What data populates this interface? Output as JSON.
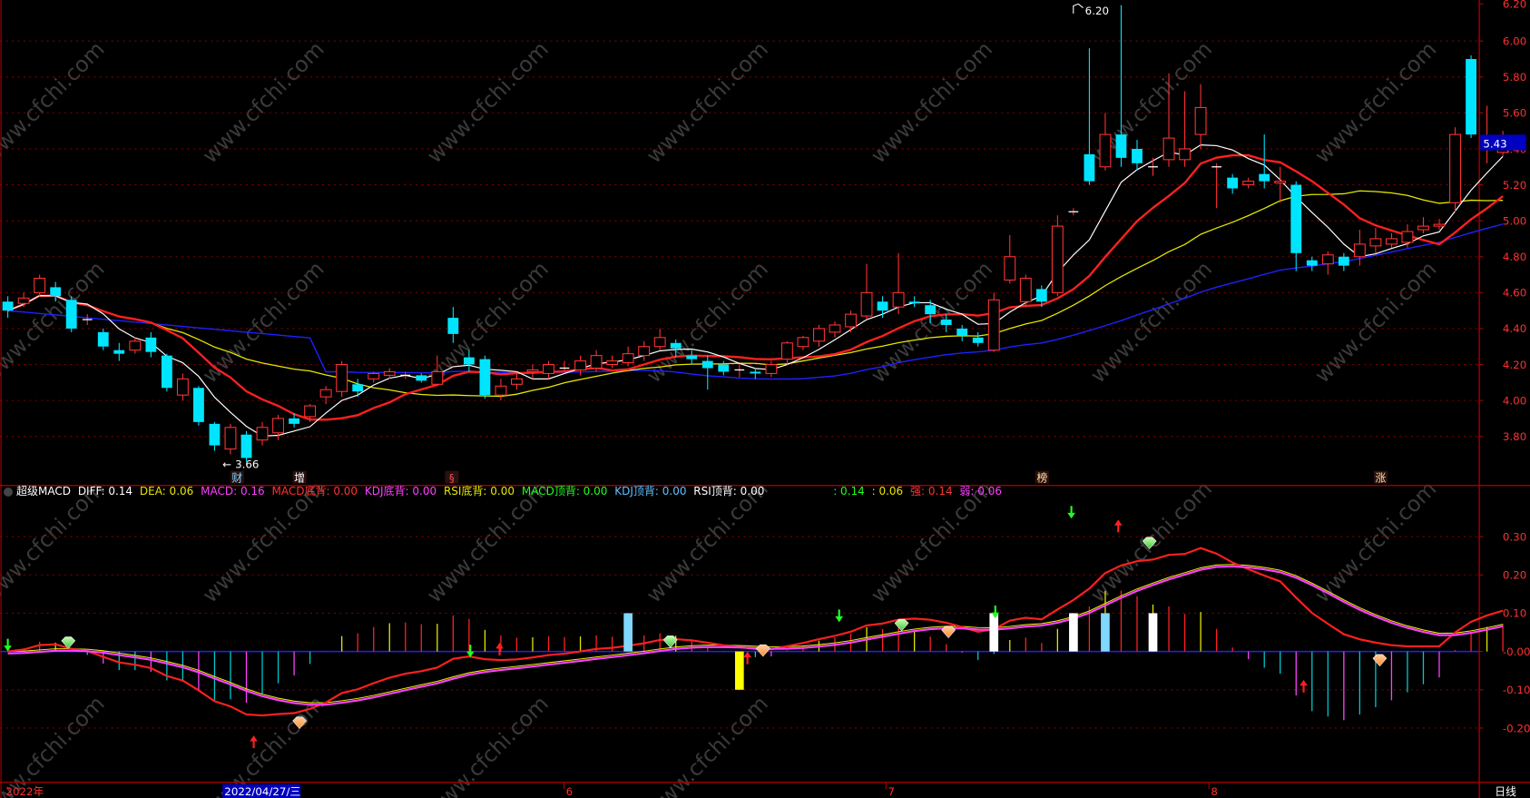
{
  "price_axis": {
    "ticks": [
      "6.20",
      "6.00",
      "5.80",
      "5.60",
      "5.40",
      "5.20",
      "5.00",
      "4.80",
      "4.60",
      "4.40",
      "4.20",
      "4.00",
      "3.80"
    ],
    "current_price": "5.43"
  },
  "indicator_axis": {
    "ticks": [
      "0.30",
      "0.20",
      "0.10",
      "-0.00",
      "-0.10",
      "-0.20"
    ]
  },
  "annotations": {
    "high_label": "6.20",
    "low_label": "3.66"
  },
  "event_markers": [
    "财",
    "增",
    "§",
    "榜",
    "涨"
  ],
  "indicator_bar": {
    "name": "超级MACD",
    "diff": "DIFF: 0.14",
    "dea": "DEA: 0.06",
    "macd": "MACD: 0.16",
    "macd_bottom_div": "MACD底背: 0.00",
    "kdj_bottom_div": "KDJ底背: 0.00",
    "rsi_bottom_div": "RSI底背: 0.00",
    "macd_top_div": "MACD顶背: 0.00",
    "kdj_top_div": "KDJ顶背: 0.00",
    "rsi_top_div": "RSI顶背: 0.00",
    "extra1": ": 0.14",
    "extra2": ": 0.06",
    "strong": "强: 0.14",
    "weak": "弱: 0.06"
  },
  "time_axis": {
    "year_label": "2022年",
    "cursor_date": "2022/04/27/三",
    "months": [
      "6",
      "7",
      "8"
    ],
    "period": "日线"
  },
  "watermark": "www.cfchi.com",
  "colors": {
    "up": "#ff3232",
    "down": "#00e5ff",
    "ma5": "#ffffff",
    "ma10": "#ff2020",
    "ma20": "#e6e600",
    "ma60": "#2020ff",
    "diff": "#ff2020",
    "dea": "#ff40ff",
    "grid": "#7a0000"
  },
  "chart_data": {
    "type": "candlestick",
    "candles": [
      [
        4.55,
        4.5,
        4.58,
        4.46
      ],
      [
        4.54,
        4.57,
        4.6,
        4.52
      ],
      [
        4.6,
        4.68,
        4.7,
        4.58
      ],
      [
        4.63,
        4.58,
        4.66,
        4.55
      ],
      [
        4.56,
        4.4,
        4.58,
        4.38
      ],
      [
        4.45,
        4.45,
        4.48,
        4.42
      ],
      [
        4.38,
        4.3,
        4.4,
        4.28
      ],
      [
        4.28,
        4.26,
        4.32,
        4.22
      ],
      [
        4.28,
        4.33,
        4.35,
        4.26
      ],
      [
        4.35,
        4.27,
        4.38,
        4.24
      ],
      [
        4.25,
        4.07,
        4.26,
        4.05
      ],
      [
        4.03,
        4.12,
        4.15,
        4.0
      ],
      [
        4.07,
        3.88,
        4.08,
        3.86
      ],
      [
        3.87,
        3.75,
        3.88,
        3.72
      ],
      [
        3.73,
        3.85,
        3.87,
        3.7
      ],
      [
        3.81,
        3.68,
        3.83,
        3.66
      ],
      [
        3.78,
        3.85,
        3.88,
        3.75
      ],
      [
        3.82,
        3.9,
        3.92,
        3.78
      ],
      [
        3.9,
        3.87,
        3.93,
        3.85
      ],
      [
        3.91,
        3.97,
        3.98,
        3.88
      ],
      [
        4.02,
        4.06,
        4.08,
        3.98
      ],
      [
        4.05,
        4.2,
        4.22,
        4.02
      ],
      [
        4.09,
        4.05,
        4.12,
        4.02
      ],
      [
        4.12,
        4.15,
        4.16,
        4.1
      ],
      [
        4.14,
        4.16,
        4.18,
        4.12
      ],
      [
        4.14,
        4.14,
        4.16,
        4.12
      ],
      [
        4.14,
        4.11,
        4.15,
        4.1
      ],
      [
        4.09,
        4.16,
        4.25,
        4.08
      ],
      [
        4.46,
        4.37,
        4.52,
        4.32
      ],
      [
        4.24,
        4.2,
        4.28,
        4.16
      ],
      [
        4.23,
        4.03,
        4.25,
        4.01
      ],
      [
        4.03,
        4.08,
        4.12,
        4.0
      ],
      [
        4.09,
        4.12,
        4.15,
        4.06
      ],
      [
        4.16,
        4.17,
        4.2,
        4.12
      ],
      [
        4.15,
        4.2,
        4.22,
        4.12
      ],
      [
        4.18,
        4.18,
        4.22,
        4.16
      ],
      [
        4.17,
        4.22,
        4.25,
        4.14
      ],
      [
        4.18,
        4.25,
        4.28,
        4.16
      ],
      [
        4.2,
        4.22,
        4.25,
        4.18
      ],
      [
        4.21,
        4.26,
        4.3,
        4.19
      ],
      [
        4.25,
        4.3,
        4.33,
        4.22
      ],
      [
        4.3,
        4.35,
        4.4,
        4.28
      ],
      [
        4.32,
        4.29,
        4.34,
        4.24
      ],
      [
        4.25,
        4.23,
        4.28,
        4.2
      ],
      [
        4.22,
        4.18,
        4.25,
        4.06
      ],
      [
        4.2,
        4.16,
        4.22,
        4.14
      ],
      [
        4.17,
        4.17,
        4.2,
        4.13
      ],
      [
        4.16,
        4.15,
        4.18,
        4.12
      ],
      [
        4.15,
        4.2,
        4.22,
        4.13
      ],
      [
        4.23,
        4.32,
        4.33,
        4.2
      ],
      [
        4.3,
        4.35,
        4.36,
        4.28
      ],
      [
        4.33,
        4.4,
        4.42,
        4.3
      ],
      [
        4.38,
        4.42,
        4.44,
        4.35
      ],
      [
        4.41,
        4.48,
        4.5,
        4.38
      ],
      [
        4.47,
        4.6,
        4.76,
        4.45
      ],
      [
        4.55,
        4.5,
        4.58,
        4.46
      ],
      [
        4.52,
        4.6,
        4.82,
        4.48
      ],
      [
        4.55,
        4.54,
        4.58,
        4.52
      ],
      [
        4.53,
        4.48,
        4.56,
        4.43
      ],
      [
        4.45,
        4.42,
        4.48,
        4.38
      ],
      [
        4.4,
        4.36,
        4.42,
        4.33
      ],
      [
        4.35,
        4.32,
        4.38,
        4.3
      ],
      [
        4.28,
        4.56,
        4.6,
        4.27
      ],
      [
        4.67,
        4.8,
        4.92,
        4.65
      ],
      [
        4.55,
        4.68,
        4.7,
        4.52
      ],
      [
        4.62,
        4.55,
        4.64,
        4.52
      ],
      [
        4.6,
        4.97,
        5.03,
        4.58
      ],
      [
        5.05,
        5.05,
        5.07,
        5.03
      ],
      [
        5.37,
        5.22,
        5.96,
        5.2
      ],
      [
        5.3,
        5.48,
        5.6,
        5.28
      ],
      [
        5.48,
        5.35,
        6.2,
        5.3
      ],
      [
        5.4,
        5.32,
        5.45,
        5.28
      ],
      [
        5.3,
        5.3,
        5.35,
        5.25
      ],
      [
        5.34,
        5.46,
        5.82,
        5.3
      ],
      [
        5.34,
        5.4,
        5.72,
        5.3
      ],
      [
        5.48,
        5.63,
        5.76,
        5.4
      ],
      [
        5.3,
        5.3,
        5.32,
        5.07
      ],
      [
        5.24,
        5.18,
        5.26,
        5.15
      ],
      [
        5.2,
        5.22,
        5.24,
        5.18
      ],
      [
        5.26,
        5.22,
        5.48,
        5.18
      ],
      [
        5.21,
        5.22,
        5.3,
        5.1
      ],
      [
        5.2,
        4.82,
        5.22,
        4.72
      ],
      [
        4.78,
        4.75,
        4.8,
        4.72
      ],
      [
        4.76,
        4.81,
        4.83,
        4.7
      ],
      [
        4.8,
        4.75,
        4.82,
        4.72
      ],
      [
        4.8,
        4.87,
        4.95,
        4.75
      ],
      [
        4.86,
        4.9,
        4.96,
        4.82
      ],
      [
        4.87,
        4.9,
        4.93,
        4.85
      ],
      [
        4.88,
        4.94,
        4.98,
        4.85
      ],
      [
        4.95,
        4.97,
        5.02,
        4.93
      ],
      [
        4.97,
        4.98,
        5.01,
        4.95
      ],
      [
        5.1,
        5.48,
        5.52,
        5.05
      ],
      [
        5.9,
        5.48,
        5.92,
        5.46
      ],
      [
        5.42,
        5.42,
        5.64,
        5.32
      ],
      [
        5.38,
        5.43,
        5.5,
        5.36
      ]
    ]
  }
}
